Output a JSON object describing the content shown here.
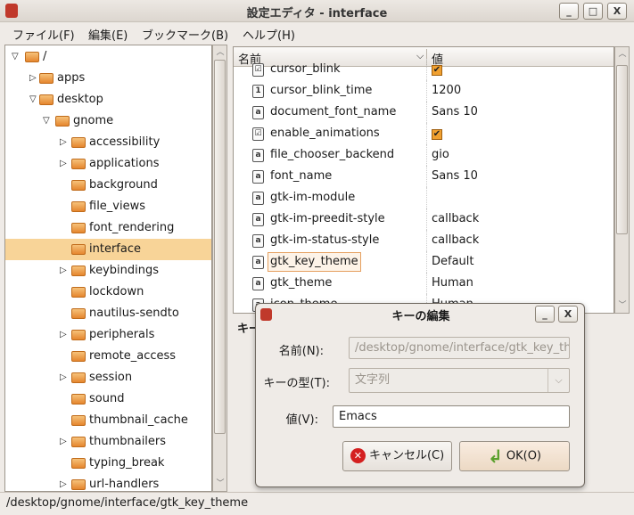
{
  "window": {
    "title": "設定エディタ - interface",
    "controls": {
      "minimize": "_",
      "maximize": "□",
      "close": "X"
    }
  },
  "menu": [
    "ファイル(F)",
    "編集(E)",
    "ブックマーク(B)",
    "ヘルプ(H)"
  ],
  "tree": [
    {
      "label": "/",
      "level": 0,
      "expander": "expanded"
    },
    {
      "label": "apps",
      "level": 1,
      "expander": "collapsed"
    },
    {
      "label": "desktop",
      "level": 1,
      "expander": "expanded"
    },
    {
      "label": "gnome",
      "level": 2,
      "expander": "expanded"
    },
    {
      "label": "accessibility",
      "level": 3,
      "expander": "collapsed"
    },
    {
      "label": "applications",
      "level": 3,
      "expander": "collapsed"
    },
    {
      "label": "background",
      "level": 3,
      "expander": "none"
    },
    {
      "label": "file_views",
      "level": 3,
      "expander": "none"
    },
    {
      "label": "font_rendering",
      "level": 3,
      "expander": "none"
    },
    {
      "label": "interface",
      "level": 3,
      "expander": "none",
      "selected": true
    },
    {
      "label": "keybindings",
      "level": 3,
      "expander": "collapsed"
    },
    {
      "label": "lockdown",
      "level": 3,
      "expander": "none"
    },
    {
      "label": "nautilus-sendto",
      "level": 3,
      "expander": "none"
    },
    {
      "label": "peripherals",
      "level": 3,
      "expander": "collapsed"
    },
    {
      "label": "remote_access",
      "level": 3,
      "expander": "none"
    },
    {
      "label": "session",
      "level": 3,
      "expander": "collapsed"
    },
    {
      "label": "sound",
      "level": 3,
      "expander": "none"
    },
    {
      "label": "thumbnail_cache",
      "level": 3,
      "expander": "none"
    },
    {
      "label": "thumbnailers",
      "level": 3,
      "expander": "collapsed"
    },
    {
      "label": "typing_break",
      "level": 3,
      "expander": "none"
    },
    {
      "label": "url-handlers",
      "level": 3,
      "expander": "collapsed"
    }
  ],
  "keys": {
    "headers": {
      "name": "名前",
      "value": "値"
    },
    "rows": [
      {
        "name": "cursor_blink",
        "type": "bool",
        "value": "✔"
      },
      {
        "name": "cursor_blink_time",
        "type": "int",
        "value": "1200"
      },
      {
        "name": "document_font_name",
        "type": "string",
        "value": "Sans 10"
      },
      {
        "name": "enable_animations",
        "type": "bool",
        "value": "✔"
      },
      {
        "name": "file_chooser_backend",
        "type": "string",
        "value": "gio"
      },
      {
        "name": "font_name",
        "type": "string",
        "value": "Sans 10"
      },
      {
        "name": "gtk-im-module",
        "type": "string",
        "value": ""
      },
      {
        "name": "gtk-im-preedit-style",
        "type": "string",
        "value": "callback"
      },
      {
        "name": "gtk-im-status-style",
        "type": "string",
        "value": "callback"
      },
      {
        "name": "gtk_key_theme",
        "type": "string",
        "value": "Default",
        "focused": true
      },
      {
        "name": "gtk_theme",
        "type": "string",
        "value": "Human"
      },
      {
        "name": "icon_theme",
        "type": "string",
        "value": "Human"
      }
    ]
  },
  "doc_label": "キー",
  "status": "/desktop/gnome/interface/gtk_key_theme",
  "dialog": {
    "title": "キーの編集",
    "controls": {
      "minimize": "_",
      "close": "X"
    },
    "name_label": "名前(N):",
    "name_value": "/desktop/gnome/interface/gtk_key_theme",
    "type_label": "キーの型(T):",
    "type_value": "文字列",
    "value_label": "値(V):",
    "value_value": "Emacs",
    "cancel": "キャンセル(C)",
    "ok": "OK(O)"
  },
  "colors": {
    "selection": "#f8d498",
    "accent": "#e5862e"
  }
}
